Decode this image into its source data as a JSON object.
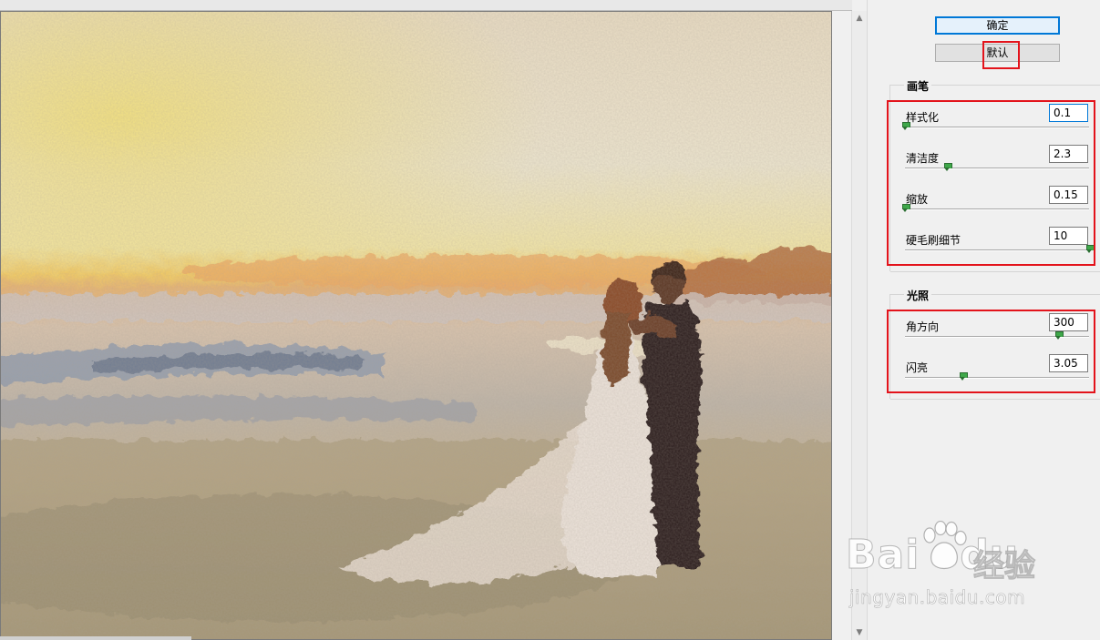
{
  "panel": {
    "ok_label": "确定",
    "default_label": "默认"
  },
  "brush_group": {
    "title": "画笔",
    "sliders": [
      {
        "label": "样式化",
        "value": "0.1",
        "level": 0.0
      },
      {
        "label": "清洁度",
        "value": "2.3",
        "level": 0.23
      },
      {
        "label": "缩放",
        "value": "0.15",
        "level": 0.0
      },
      {
        "label": "硬毛刷细节",
        "value": "10",
        "level": 1.0
      }
    ]
  },
  "lighting_group": {
    "title": "光照",
    "sliders": [
      {
        "label": "角方向",
        "value": "300",
        "level": 0.83
      },
      {
        "label": "闪亮",
        "value": "3.05",
        "level": 0.31
      }
    ]
  },
  "watermark": {
    "brand": "Bai",
    "brand_tail": "du",
    "cn": "经验",
    "url": "jingyan.baidu.com"
  },
  "icons": [
    "scroll-up-arrow-icon",
    "scroll-down-arrow-icon",
    "slider-thumb-icon",
    "baidu-paw-icon"
  ],
  "colors": {
    "highlight_red": "#e3131b",
    "focus_blue": "#0078d7",
    "thumb_green": "#3fa84a"
  }
}
